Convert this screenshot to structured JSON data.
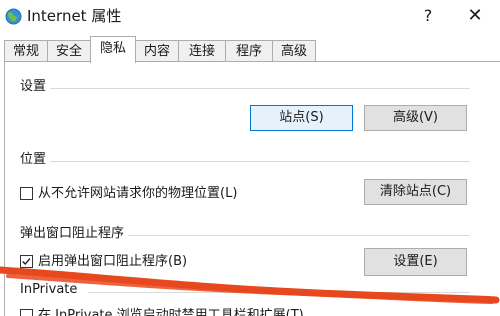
{
  "window": {
    "title": "Internet 属性",
    "help_label": "?",
    "close_label": "✕",
    "icon": "globe-icon"
  },
  "tabs": [
    {
      "label": "常规",
      "active": false
    },
    {
      "label": "安全",
      "active": false
    },
    {
      "label": "隐私",
      "active": true
    },
    {
      "label": "内容",
      "active": false
    },
    {
      "label": "连接",
      "active": false
    },
    {
      "label": "程序",
      "active": false
    },
    {
      "label": "高级",
      "active": false
    }
  ],
  "settings": {
    "heading": "设置",
    "sites_button": "站点(S)",
    "advanced_button": "高级(V)"
  },
  "location": {
    "heading": "位置",
    "checkbox_label": "从不允许网站请求你的物理位置(L)",
    "checked": false,
    "clear_sites_button": "清除站点(C)"
  },
  "popup_blocker": {
    "heading": "弹出窗口阻止程序",
    "checkbox_label": "启用弹出窗口阻止程序(B)",
    "checked": true,
    "settings_button": "设置(E)"
  },
  "inprivate": {
    "heading": "InPrivate",
    "checkbox_partial_label": "在 InPrivate 浏览启动时禁用工具栏和扩展(T)"
  },
  "colors": {
    "scribble": "#e8481d",
    "accent": "#0078d7"
  }
}
